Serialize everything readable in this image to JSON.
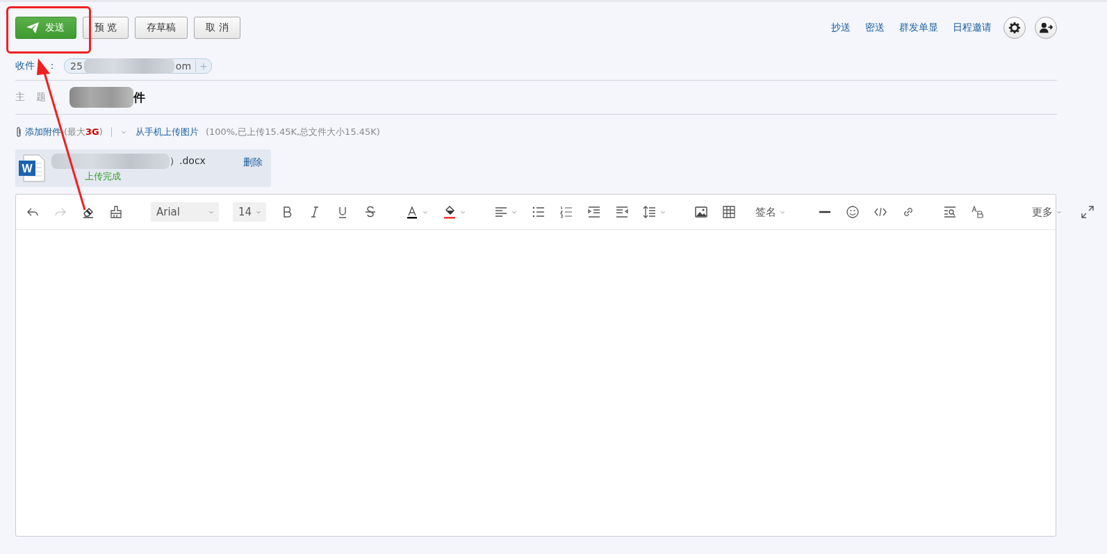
{
  "actions": [
    {
      "label": "发送",
      "kind": "primary"
    },
    {
      "label": "预 览",
      "kind": "plain"
    },
    {
      "label": "存草稿",
      "kind": "plain"
    },
    {
      "label": "取 消",
      "kind": "plain"
    }
  ],
  "header_links": [
    "抄送",
    "密送",
    "群发单显",
    "日程邀请"
  ],
  "recipient": {
    "label": "收件",
    "colon": "：",
    "chip_start": "25",
    "chip_end": "om",
    "add": "+"
  },
  "subject": {
    "label": "主　题",
    "value_end": "件"
  },
  "attachments_bar": {
    "add": "添加附件",
    "limit_prefix": "(最大",
    "limit_value": "3G",
    "limit_suffix": ")",
    "phone_upload": "从手机上传图片",
    "progress": "(100%,已上传15.45K,总文件大小15.45K)"
  },
  "attachment": {
    "badge": "W",
    "name_end": "）.docx",
    "delete": "删除",
    "status": "上传完成"
  },
  "toolbar": {
    "redo_disabled": true,
    "font": "Arial",
    "size": "14",
    "signature": "签名",
    "more": "更多"
  }
}
